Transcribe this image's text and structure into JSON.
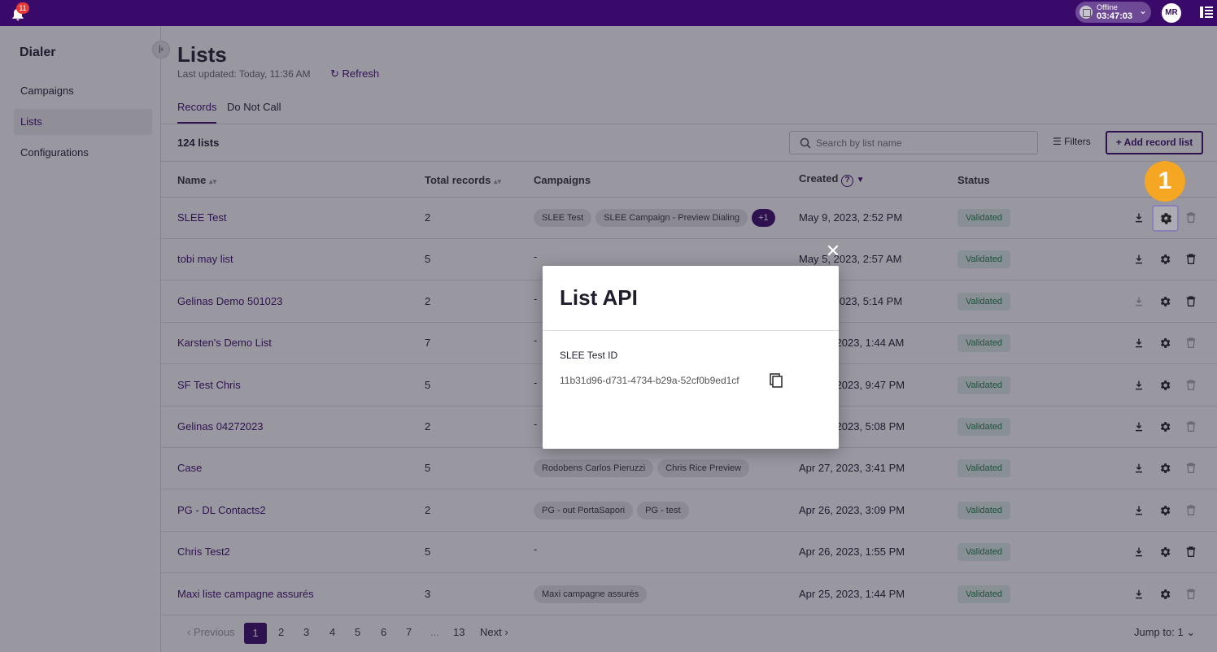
{
  "topbar": {
    "notification_count": "11",
    "status_label": "Offline",
    "status_time": "03:47:03",
    "avatar_initials": "MR"
  },
  "sidebar": {
    "title": "Dialer",
    "items": [
      {
        "label": "Campaigns",
        "active": false
      },
      {
        "label": "Lists",
        "active": true
      },
      {
        "label": "Configurations",
        "active": false
      }
    ]
  },
  "header": {
    "title": "Lists",
    "updated": "Last updated: Today, 11:36 AM",
    "refresh_label": "Refresh"
  },
  "tabs": [
    {
      "label": "Records",
      "active": true
    },
    {
      "label": "Do Not Call",
      "active": false
    }
  ],
  "toolbar": {
    "count": "124 lists",
    "search_placeholder": "Search by list name",
    "filters_label": "Filters",
    "add_label": "Add record list"
  },
  "table": {
    "columns": [
      "Name",
      "Total records",
      "Campaigns",
      "Created",
      "Status"
    ],
    "rows": [
      {
        "name": "SLEE Test",
        "records": "2",
        "campaigns": [
          "SLEE Test",
          "SLEE Campaign - Preview Dialing"
        ],
        "more": "+1",
        "created": "May 9, 2023, 2:52 PM",
        "status": "Validated",
        "download_enabled": true,
        "delete_enabled": false
      },
      {
        "name": "tobi may list",
        "records": "5",
        "campaigns": [],
        "created": "May 5, 2023, 2:57 AM",
        "status": "Validated",
        "download_enabled": true,
        "delete_enabled": true
      },
      {
        "name": "Gelinas Demo 501023",
        "records": "2",
        "campaigns": [],
        "created": "May 1, 2023, 5:14 PM",
        "status": "Validated",
        "download_enabled": false,
        "delete_enabled": true
      },
      {
        "name": "Karsten's Demo List",
        "records": "7",
        "campaigns": [],
        "created": "Apr 30, 2023, 1:44 AM",
        "status": "Validated",
        "download_enabled": true,
        "delete_enabled": false
      },
      {
        "name": "SF Test Chris",
        "records": "5",
        "campaigns": [],
        "created": "Apr 28, 2023, 9:47 PM",
        "status": "Validated",
        "download_enabled": true,
        "delete_enabled": false
      },
      {
        "name": "Gelinas 04272023",
        "records": "2",
        "campaigns": [],
        "created": "Apr 27, 2023, 5:08 PM",
        "status": "Validated",
        "download_enabled": true,
        "delete_enabled": false
      },
      {
        "name": "Case",
        "records": "5",
        "campaigns": [
          "Rodobens Carlos Pieruzzi",
          "Chris Rice Preview"
        ],
        "created": "Apr 27, 2023, 3:41 PM",
        "status": "Validated",
        "download_enabled": true,
        "delete_enabled": false
      },
      {
        "name": "PG - DL Contacts2",
        "records": "2",
        "campaigns": [
          "PG - out PortaSapori",
          "PG - test"
        ],
        "created": "Apr 26, 2023, 3:09 PM",
        "status": "Validated",
        "download_enabled": true,
        "delete_enabled": false
      },
      {
        "name": "Chris Test2",
        "records": "5",
        "campaigns": [],
        "created": "Apr 26, 2023, 1:55 PM",
        "status": "Validated",
        "download_enabled": true,
        "delete_enabled": true
      },
      {
        "name": "Maxi liste campagne assurés",
        "records": "3",
        "campaigns": [
          "Maxi campagne assurés"
        ],
        "created": "Apr 25, 2023, 1:44 PM",
        "status": "Validated",
        "download_enabled": true,
        "delete_enabled": false
      }
    ]
  },
  "pagination": {
    "previous": "Previous",
    "pages": [
      "1",
      "2",
      "3",
      "4",
      "5",
      "6",
      "7",
      "...",
      "13"
    ],
    "next": "Next",
    "jump_label": "Jump to:",
    "jump_value": "1"
  },
  "step_badge": "1",
  "modal": {
    "title": "List API",
    "label": "SLEE Test ID",
    "id_value": "11b31d96-d731-4734-b29a-52cf0b9ed1cf"
  },
  "colors": {
    "brand": "#3a0a6b",
    "accent_badge": "#f5a623",
    "status_green": "#1a7d47"
  }
}
